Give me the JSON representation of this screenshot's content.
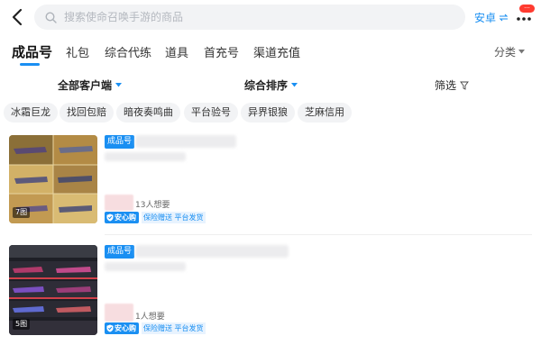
{
  "search": {
    "placeholder": "搜索使命召唤手游的商品"
  },
  "header": {
    "platform_label": "安卓",
    "more_badge": "···"
  },
  "tabs": [
    "成品号",
    "礼包",
    "综合代练",
    "道具",
    "首充号",
    "渠道充值"
  ],
  "tab_more_label": "分类",
  "filters": {
    "client": "全部客户端",
    "sort": "综合排序",
    "filter": "筛选"
  },
  "chips": [
    "冰霜巨龙",
    "找回包赔",
    "暗夜奏鸣曲",
    "平台验号",
    "异界银狼",
    "芝麻信用"
  ],
  "items": [
    {
      "tag": "成品号",
      "image_count": "7图",
      "wants": "13人想要",
      "safe_badge": "安心购",
      "badge_text": "保险赠送 平台发货"
    },
    {
      "tag": "成品号",
      "image_count": "5图",
      "wants": "1人想要",
      "safe_badge": "安心购",
      "badge_text": "保险赠送 平台发货"
    }
  ],
  "colors": {
    "accent": "#1a8ff2",
    "badge_red": "#ff3b30"
  }
}
